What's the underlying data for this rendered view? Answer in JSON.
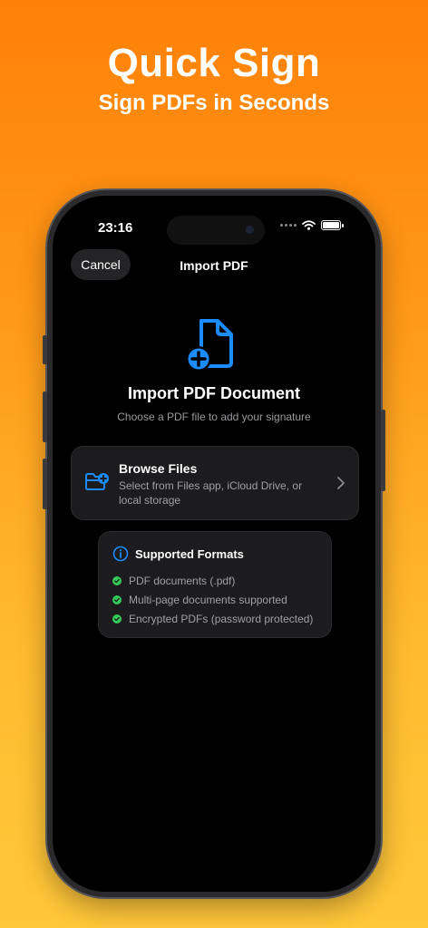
{
  "hero": {
    "title": "Quick Sign",
    "subtitle": "Sign PDFs in Seconds"
  },
  "status_bar": {
    "time": "23:16"
  },
  "nav": {
    "cancel_label": "Cancel",
    "title": "Import PDF"
  },
  "main": {
    "title": "Import PDF Document",
    "subtitle": "Choose a PDF file to add your signature"
  },
  "browse": {
    "title": "Browse Files",
    "description": "Select from Files app, iCloud Drive, or local storage"
  },
  "formats": {
    "title": "Supported Formats",
    "items": [
      "PDF documents (.pdf)",
      "Multi-page documents supported",
      "Encrypted PDFs (password protected)"
    ]
  },
  "colors": {
    "accent": "#1a8cff",
    "check": "#34c759",
    "background_top": "#ff8008",
    "background_bottom": "#ffc73a"
  }
}
